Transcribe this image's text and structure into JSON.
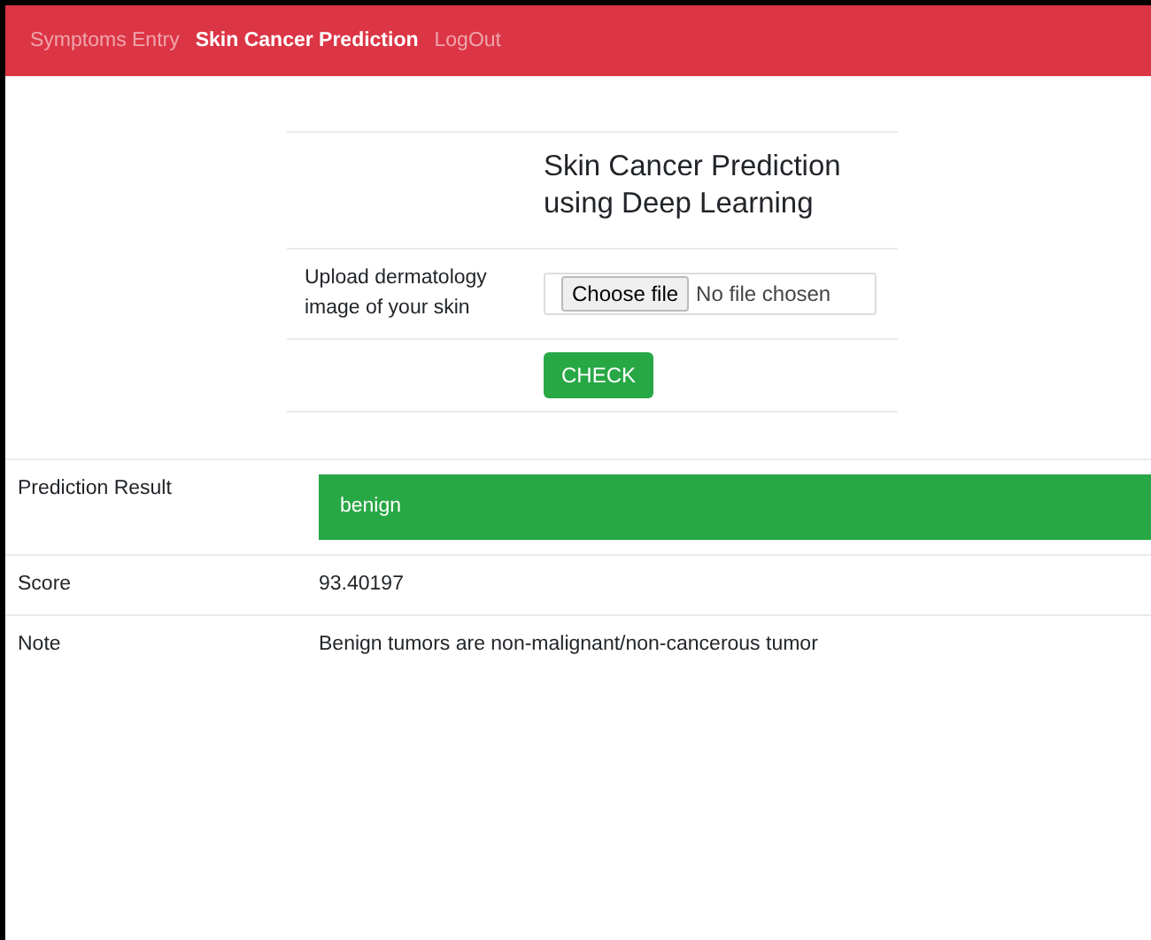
{
  "nav": [
    {
      "label": "Symptoms Entry",
      "selected": false
    },
    {
      "label": "Skin Cancer Prediction",
      "selected": true
    },
    {
      "label": "LogOut",
      "selected": false
    }
  ],
  "form": {
    "title": "Skin Cancer Prediction using Deep Learning",
    "upload_label": "Upload dermatology image of your skin",
    "file_button": "Choose file",
    "file_status": "No file chosen",
    "submit": "CHECK"
  },
  "results": [
    {
      "kind": "badge",
      "label": "Prediction Result",
      "value": "benign"
    },
    {
      "kind": "text",
      "label": "Score",
      "value": "93.40197"
    },
    {
      "kind": "text",
      "label": "Note",
      "value": "Benign tumors are non-malignant/non-cancerous tumor"
    }
  ]
}
